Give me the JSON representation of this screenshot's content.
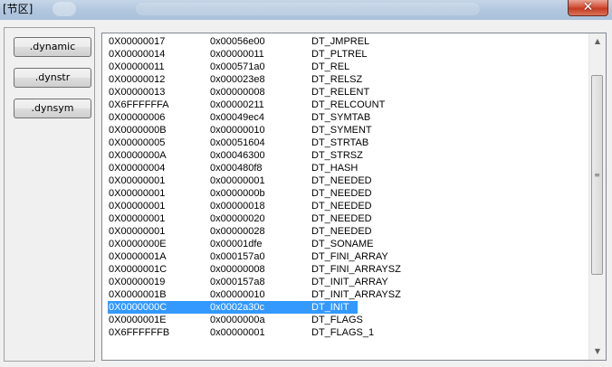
{
  "window": {
    "title": "[节区]",
    "close_glyph": "✕"
  },
  "sidebar": {
    "buttons": [
      {
        "label": ".dynamic"
      },
      {
        "label": ".dynstr"
      },
      {
        "label": ".dynsym"
      }
    ]
  },
  "list": {
    "rows": [
      [
        "0X00000017",
        "0x00056e00",
        "DT_JMPREL"
      ],
      [
        "0X00000014",
        "0x00000011",
        "DT_PLTREL"
      ],
      [
        "0X00000011",
        "0x000571a0",
        "DT_REL"
      ],
      [
        "0X00000012",
        "0x000023e8",
        "DT_RELSZ"
      ],
      [
        "0X00000013",
        "0x00000008",
        "DT_RELENT"
      ],
      [
        "0X6FFFFFFA",
        "0x00000211",
        "DT_RELCOUNT"
      ],
      [
        "0X00000006",
        "0x00049ec4",
        "DT_SYMTAB"
      ],
      [
        "0X0000000B",
        "0x00000010",
        "DT_SYMENT"
      ],
      [
        "0X00000005",
        "0x00051604",
        "DT_STRTAB"
      ],
      [
        "0X0000000A",
        "0x00046300",
        "DT_STRSZ"
      ],
      [
        "0X00000004",
        "0x000480f8",
        "DT_HASH"
      ],
      [
        "0X00000001",
        "0x00000001",
        "DT_NEEDED"
      ],
      [
        "0X00000001",
        "0x0000000b",
        "DT_NEEDED"
      ],
      [
        "0X00000001",
        "0x00000018",
        "DT_NEEDED"
      ],
      [
        "0X00000001",
        "0x00000020",
        "DT_NEEDED"
      ],
      [
        "0X00000001",
        "0x00000028",
        "DT_NEEDED"
      ],
      [
        "0X0000000E",
        "0x00001dfe",
        "DT_SONAME"
      ],
      [
        "0X0000001A",
        "0x000157a0",
        "DT_FINI_ARRAY"
      ],
      [
        "0X0000001C",
        "0x00000008",
        "DT_FINI_ARRAYSZ"
      ],
      [
        "0X00000019",
        "0x000157a8",
        "DT_INIT_ARRAY"
      ],
      [
        "0X0000001B",
        "0x00000010",
        "DT_INIT_ARRAYSZ"
      ],
      [
        "0X0000000C",
        "0x0002a30c",
        "DT_INIT"
      ],
      [
        "0X0000001E",
        "0x0000000a",
        "DT_FLAGS"
      ],
      [
        "0X6FFFFFFB",
        "0x00000001",
        "DT_FLAGS_1"
      ]
    ],
    "selected_index": 21
  },
  "scrollbar": {
    "up_glyph": "▲",
    "down_glyph": "▼",
    "grip_glyph": "≡"
  },
  "colors": {
    "selection": "#3399ff",
    "titlebar": "#b3c8df",
    "close": "#c43c22"
  }
}
